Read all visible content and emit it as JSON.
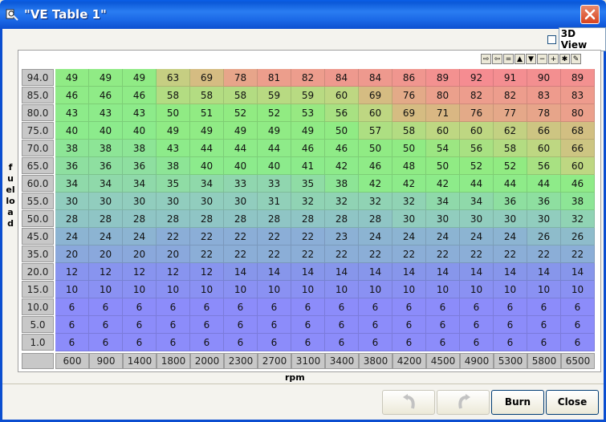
{
  "window": {
    "title": "\"VE Table 1\"",
    "title_bar_color": "#0b5be0",
    "close_icon": "close-x-icon"
  },
  "view3d": {
    "label": "3D View",
    "checked": false
  },
  "toolbar": {
    "buttons": [
      "⇨",
      "⇦",
      "=",
      "▲",
      "▼",
      "−",
      "+",
      "✱",
      "✎"
    ]
  },
  "axes": {
    "y_label": "fuelload",
    "x_label": "rpm"
  },
  "table": {
    "rows": [
      "94.0",
      "85.0",
      "80.0",
      "75.0",
      "70.0",
      "65.0",
      "60.0",
      "55.0",
      "50.0",
      "45.0",
      "35.0",
      "20.0",
      "15.0",
      "10.0",
      "5.0",
      "1.0"
    ],
    "cols": [
      "600",
      "900",
      "1400",
      "1800",
      "2000",
      "2300",
      "2700",
      "3100",
      "3400",
      "3800",
      "4200",
      "4500",
      "4900",
      "5300",
      "5800",
      "6500"
    ],
    "values": [
      [
        49,
        49,
        49,
        63,
        69,
        78,
        81,
        82,
        84,
        84,
        86,
        89,
        92,
        91,
        90,
        89
      ],
      [
        46,
        46,
        46,
        58,
        58,
        58,
        59,
        59,
        60,
        69,
        76,
        80,
        82,
        82,
        83,
        83
      ],
      [
        43,
        43,
        43,
        50,
        51,
        52,
        52,
        53,
        56,
        60,
        69,
        71,
        76,
        77,
        78,
        80
      ],
      [
        40,
        40,
        40,
        49,
        49,
        49,
        49,
        49,
        50,
        57,
        58,
        60,
        60,
        62,
        66,
        68
      ],
      [
        38,
        38,
        38,
        43,
        44,
        44,
        44,
        46,
        46,
        50,
        50,
        54,
        56,
        58,
        60,
        66
      ],
      [
        36,
        36,
        36,
        38,
        40,
        40,
        40,
        41,
        42,
        46,
        48,
        50,
        52,
        52,
        56,
        60
      ],
      [
        34,
        34,
        34,
        35,
        34,
        33,
        33,
        35,
        38,
        42,
        42,
        42,
        44,
        44,
        44,
        46
      ],
      [
        30,
        30,
        30,
        30,
        30,
        30,
        31,
        32,
        32,
        32,
        32,
        34,
        34,
        36,
        36,
        38
      ],
      [
        28,
        28,
        28,
        28,
        28,
        28,
        28,
        28,
        28,
        28,
        30,
        30,
        30,
        30,
        30,
        32
      ],
      [
        24,
        24,
        24,
        22,
        22,
        22,
        22,
        22,
        23,
        24,
        24,
        24,
        24,
        24,
        26,
        26
      ],
      [
        20,
        20,
        20,
        20,
        22,
        22,
        22,
        22,
        22,
        22,
        22,
        22,
        22,
        22,
        22,
        22
      ],
      [
        12,
        12,
        12,
        12,
        12,
        14,
        14,
        14,
        14,
        14,
        14,
        14,
        14,
        14,
        14,
        14
      ],
      [
        10,
        10,
        10,
        10,
        10,
        10,
        10,
        10,
        10,
        10,
        10,
        10,
        10,
        10,
        10,
        10
      ],
      [
        6,
        6,
        6,
        6,
        6,
        6,
        6,
        6,
        6,
        6,
        6,
        6,
        6,
        6,
        6,
        6
      ],
      [
        6,
        6,
        6,
        6,
        6,
        6,
        6,
        6,
        6,
        6,
        6,
        6,
        6,
        6,
        6,
        6
      ],
      [
        6,
        6,
        6,
        6,
        6,
        6,
        6,
        6,
        6,
        6,
        6,
        6,
        6,
        6,
        6,
        6
      ]
    ]
  },
  "buttons": {
    "undo_icon": "undo-arrow-icon",
    "redo_icon": "redo-arrow-icon",
    "burn": "Burn",
    "close": "Close"
  }
}
